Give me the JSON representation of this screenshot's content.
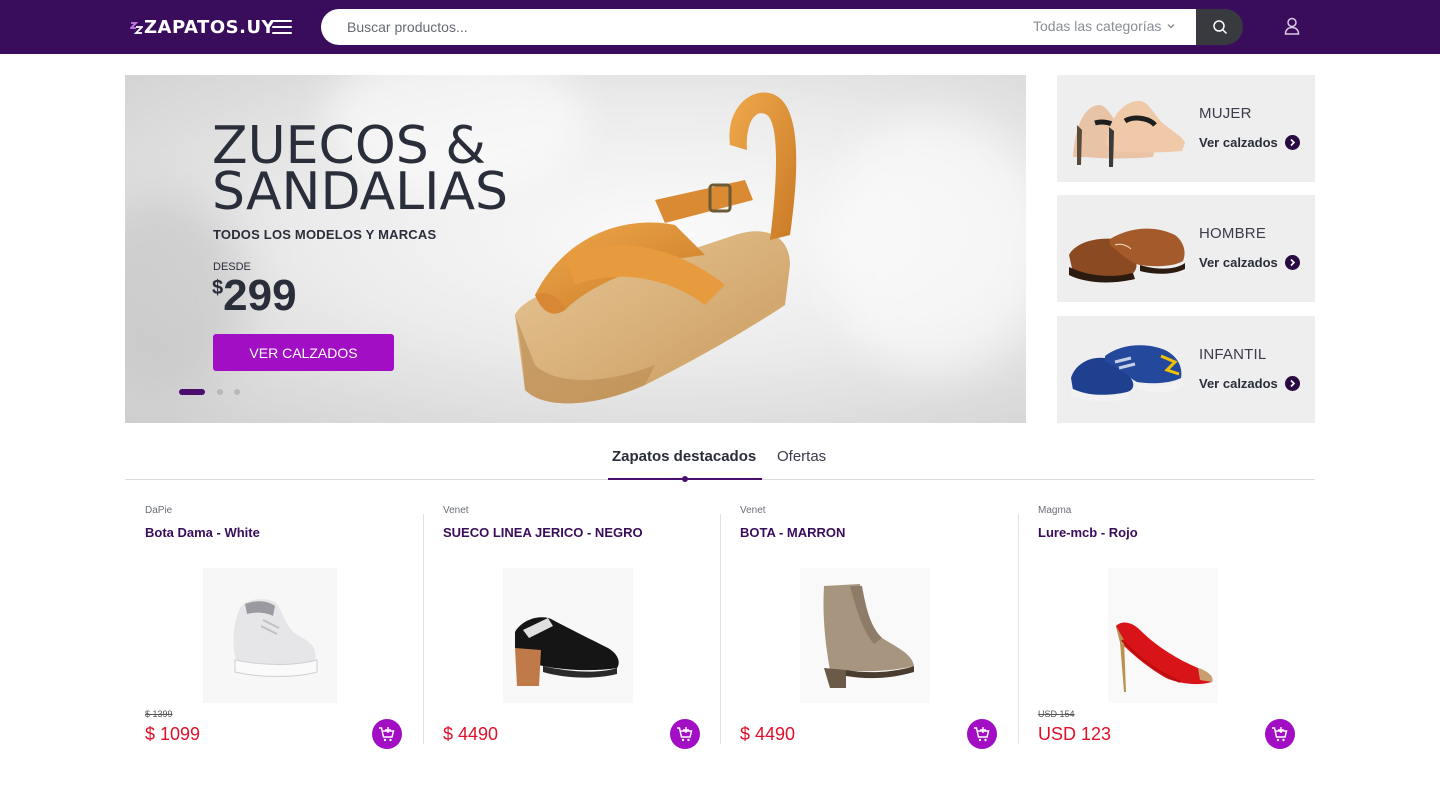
{
  "header": {
    "logo_text": "ZAPATOS.UY",
    "search_placeholder": "Buscar productos...",
    "category_select": "Todas las categorías",
    "brand_color": "#3a0d5c",
    "accent_color": "#a10ec4"
  },
  "hero": {
    "title": "ZUECOS &\nSANDALIAS",
    "subtitle": "TODOS LOS MODELOS Y MARCAS",
    "from_label": "DESDE",
    "currency": "$",
    "price": "299",
    "button_label": "VER CALZADOS",
    "slides_total": 3,
    "active_slide": 1
  },
  "categories": [
    {
      "name": "MUJER",
      "link": "Ver calzados",
      "icon": "women-heels-image"
    },
    {
      "name": "HOMBRE",
      "link": "Ver calzados",
      "icon": "men-shoes-image"
    },
    {
      "name": "INFANTIL",
      "link": "Ver calzados",
      "icon": "kids-sneakers-image"
    }
  ],
  "tabs": [
    {
      "label": "Zapatos destacados",
      "active": true
    },
    {
      "label": "Ofertas",
      "active": false
    }
  ],
  "products": [
    {
      "brand": "DaPie",
      "name": "Bota Dama - White",
      "old_price": "$ 1399",
      "price": "$ 1099",
      "icon": "white-sneaker-boot-image"
    },
    {
      "brand": "Venet",
      "name": "SUECO LINEA JERICO - NEGRO",
      "old_price": "",
      "price": "$ 4490",
      "icon": "black-clog-image"
    },
    {
      "brand": "Venet",
      "name": "BOTA - MARRON",
      "old_price": "",
      "price": "$ 4490",
      "icon": "brown-ankle-boot-image"
    },
    {
      "brand": "Magma",
      "name": "Lure-mcb - Rojo",
      "old_price": "USD 154",
      "price": "USD 123",
      "icon": "red-pump-image"
    }
  ]
}
